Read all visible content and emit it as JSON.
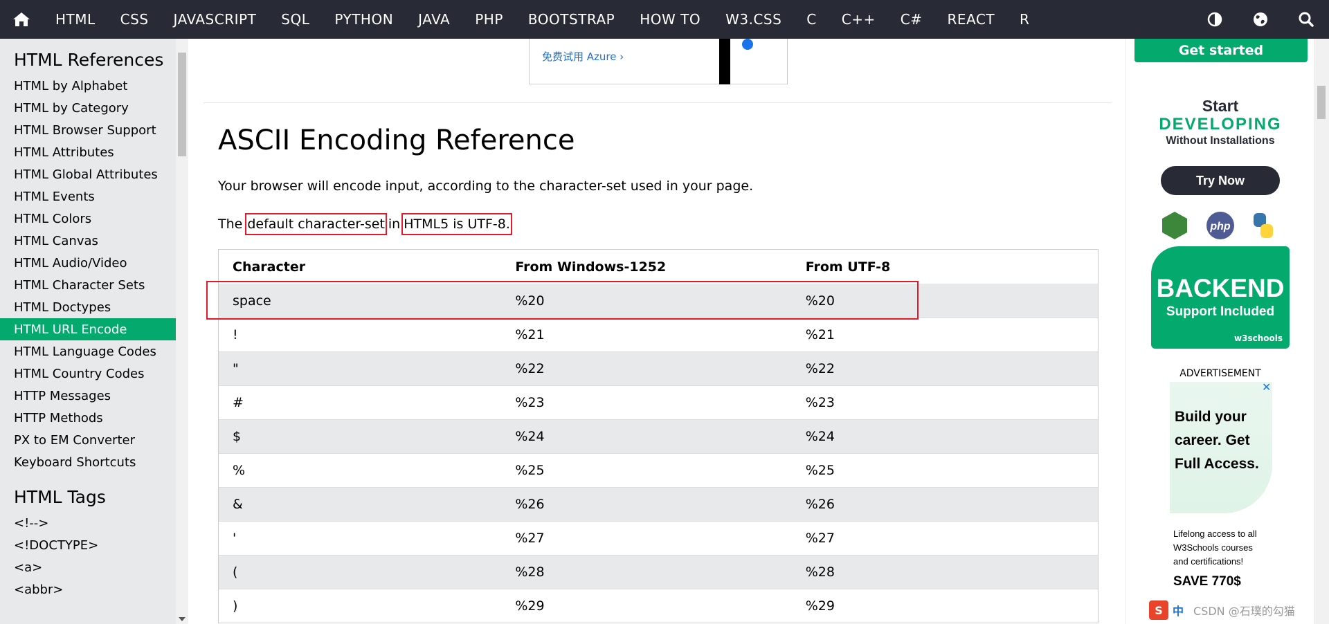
{
  "nav": {
    "items": [
      "HTML",
      "CSS",
      "JAVASCRIPT",
      "SQL",
      "PYTHON",
      "JAVA",
      "PHP",
      "BOOTSTRAP",
      "HOW TO",
      "W3.CSS",
      "C",
      "C++",
      "C#",
      "REACT",
      "R"
    ],
    "icons": [
      "home-icon",
      "contrast-icon",
      "globe-icon",
      "search-icon"
    ]
  },
  "sidebar": {
    "heading1": "HTML References",
    "items": [
      "HTML by Alphabet",
      "HTML by Category",
      "HTML Browser Support",
      "HTML Attributes",
      "HTML Global Attributes",
      "HTML Events",
      "HTML Colors",
      "HTML Canvas",
      "HTML Audio/Video",
      "HTML Character Sets",
      "HTML Doctypes",
      "HTML URL Encode",
      "HTML Language Codes",
      "HTML Country Codes",
      "HTTP Messages",
      "HTTP Methods",
      "PX to EM Converter",
      "Keyboard Shortcuts"
    ],
    "active": "HTML URL Encode",
    "heading2": "HTML Tags",
    "tags": [
      "<!-->",
      "<!DOCTYPE>",
      "<a>",
      "<abbr>"
    ]
  },
  "ad_top": {
    "link": "免费试用 Azure ›"
  },
  "main": {
    "title": "ASCII Encoding Reference",
    "intro": "Your browser will encode input, according to the character-set used in your page.",
    "charset": {
      "prefix": "The",
      "boxed1": "default character-set",
      "middle": "in",
      "boxed2": "HTML5 is UTF-8."
    }
  },
  "table": {
    "headers": [
      "Character",
      "From Windows-1252",
      "From UTF-8"
    ],
    "rows": [
      [
        "space",
        "%20",
        "%20"
      ],
      [
        "!",
        "%21",
        "%21"
      ],
      [
        "\"",
        "%22",
        "%22"
      ],
      [
        "#",
        "%23",
        "%23"
      ],
      [
        "$",
        "%24",
        "%24"
      ],
      [
        "%",
        "%25",
        "%25"
      ],
      [
        "&",
        "%26",
        "%26"
      ],
      [
        "'",
        "%27",
        "%27"
      ],
      [
        "(",
        "%28",
        "%28"
      ],
      [
        ")",
        "%29",
        "%29"
      ]
    ]
  },
  "right": {
    "get_started": "Get started",
    "start": "Start",
    "developing": "DEVELOPING",
    "without": "Without Installations",
    "try_now": "Try Now",
    "backend": "BACKEND",
    "backend_sub": "Support Included",
    "backend_brand": "w3schools",
    "ad_label": "ADVERTISEMENT",
    "ad_headline": "Build your career. Get Full Access.",
    "ad_small": "Lifelong access to all W3Schools courses and certifications!",
    "ad_save": "SAVE 770$"
  },
  "ime": {
    "label": "中",
    "watermark": "CSDN @石璞的勾猫"
  },
  "colors": {
    "nav_bg": "#282a35",
    "accent": "#04aa6d",
    "sidebar_bg": "#e7e9eb",
    "highlight": "#e21b2a"
  }
}
